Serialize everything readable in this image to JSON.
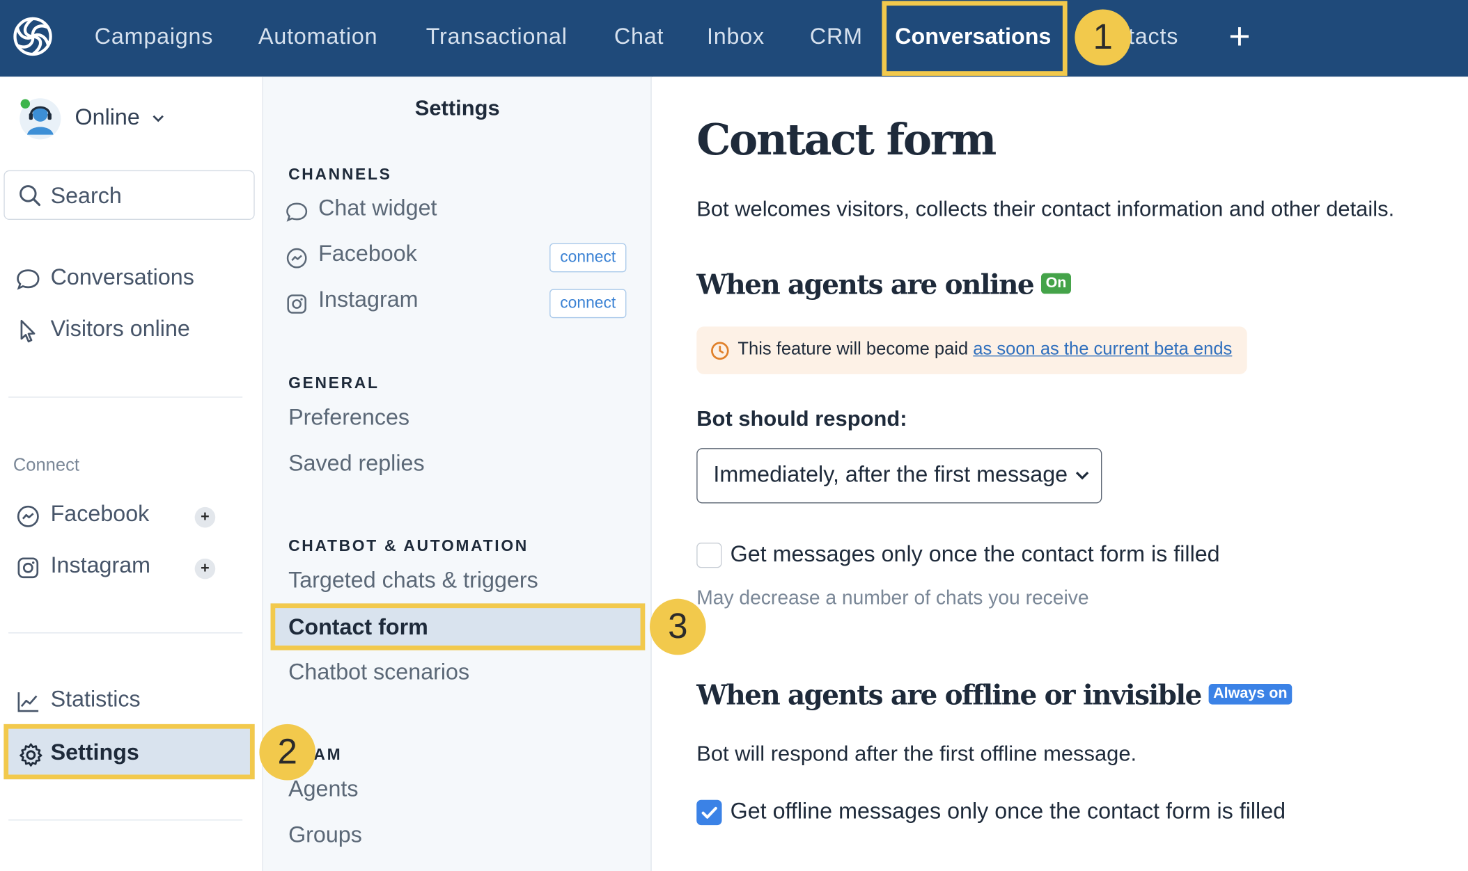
{
  "nav": {
    "items": [
      "Campaigns",
      "Automation",
      "Transactional",
      "Chat",
      "Inbox",
      "CRM",
      "Conversations",
      "Contacts"
    ],
    "active": "Conversations",
    "visible_partial": "tacts"
  },
  "annotations": {
    "step1": "1",
    "step2": "2",
    "step3": "3"
  },
  "sidebar": {
    "status": "Online",
    "search_placeholder": "Search",
    "items": {
      "conversations": "Conversations",
      "visitors": "Visitors online"
    },
    "connect_heading": "Connect",
    "connect_items": {
      "facebook": "Facebook",
      "instagram": "Instagram"
    },
    "plus": "+",
    "statistics": "Statistics",
    "settings": "Settings"
  },
  "settings": {
    "title": "Settings",
    "channels_heading": "CHANNELS",
    "chat_widget": "Chat widget",
    "facebook": "Facebook",
    "instagram": "Instagram",
    "connect_label": "connect",
    "general_heading": "GENERAL",
    "preferences": "Preferences",
    "saved_replies": "Saved replies",
    "chatbot_heading": "CHATBOT & AUTOMATION",
    "targeted": "Targeted chats & triggers",
    "contact_form": "Contact form",
    "chatbot_scenarios": "Chatbot scenarios",
    "team_heading": "AM",
    "agents": "Agents",
    "groups": "Groups"
  },
  "main": {
    "title": "Contact form",
    "description": "Bot welcomes visitors, collects their contact information and other details.",
    "online_heading": "When agents are online",
    "online_badge": "On",
    "notice_text": "This feature will become paid ",
    "notice_link": "as soon as the current beta ends",
    "respond_label": "Bot should respond:",
    "respond_value": "Immediately, after the first message",
    "check1_label": "Get messages only once the contact form is filled",
    "check1_checked": false,
    "check1_hint": "May decrease a number of chats you receive",
    "offline_heading": "When agents are offline or invisible",
    "offline_badge": "Always on",
    "offline_text": "Bot will respond after the first offline message.",
    "check2_label": "Get offline messages only once the contact form is filled",
    "check2_checked": true
  },
  "colors": {
    "nav_bg": "#1f4a7a",
    "highlight": "#f2c94c",
    "selected_bg": "#d9e3ee",
    "accent_blue": "#3b82e6",
    "badge_green": "#44a349"
  }
}
